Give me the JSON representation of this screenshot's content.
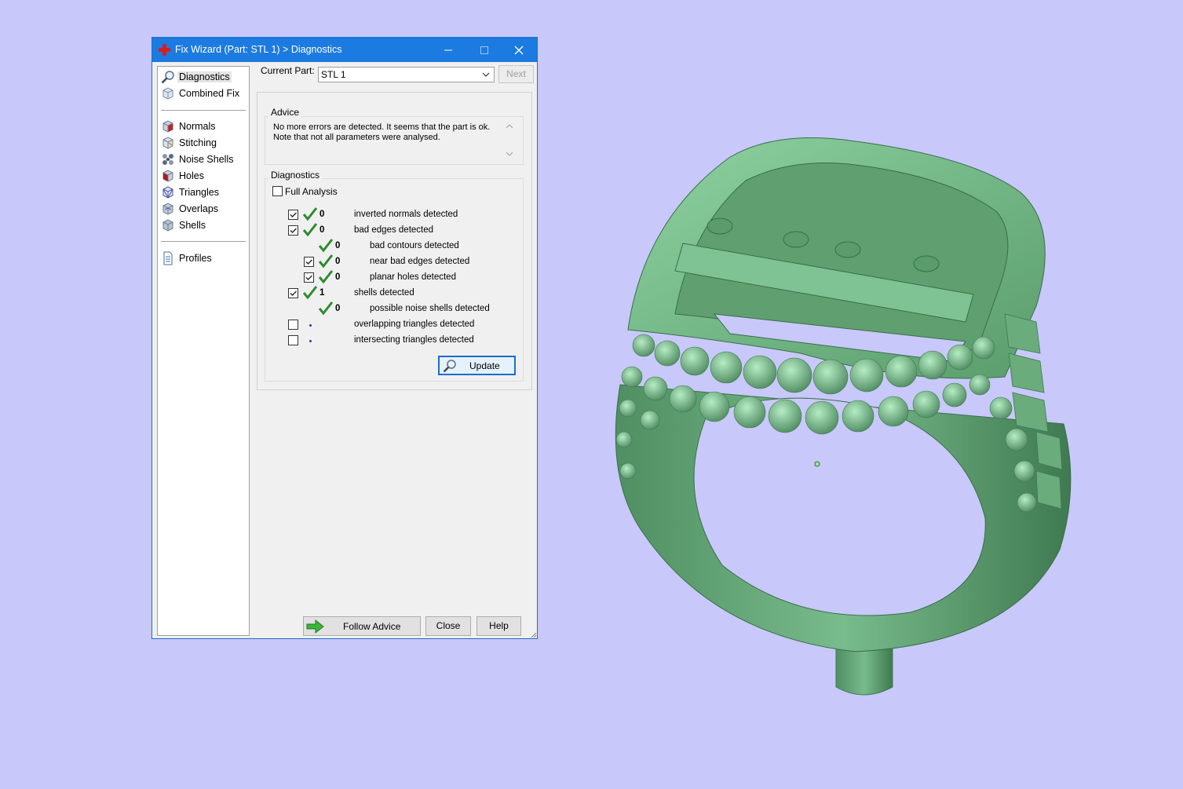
{
  "colors": {
    "background": "#c8c8fa",
    "titlebar": "#1c7be0",
    "ring_green": "#6bb07f",
    "check_green": "#2e8b2e",
    "app_icon_red": "#d42020"
  },
  "window": {
    "title": "Fix Wizard (Part: STL 1) > Diagnostics",
    "controls": [
      "minimize-icon",
      "maximize-icon",
      "close-icon"
    ]
  },
  "nav": {
    "group1": [
      {
        "label": "Diagnostics",
        "icon": "magnifier-icon",
        "selected": true
      },
      {
        "label": "Combined Fix",
        "icon": "cube-icon"
      }
    ],
    "group2": [
      {
        "label": "Normals",
        "icon": "cube-red-face-icon"
      },
      {
        "label": "Stitching",
        "icon": "cube-stitch-icon"
      },
      {
        "label": "Noise Shells",
        "icon": "noise-shells-icon"
      },
      {
        "label": "Holes",
        "icon": "cube-holes-icon"
      },
      {
        "label": "Triangles",
        "icon": "cube-triangles-icon"
      },
      {
        "label": "Overlaps",
        "icon": "cube-overlaps-icon"
      },
      {
        "label": "Shells",
        "icon": "cube-shells-icon"
      }
    ],
    "group3": [
      {
        "label": "Profiles",
        "icon": "document-icon"
      }
    ]
  },
  "current_part": {
    "label": "Current Part:",
    "value": "STL 1",
    "next_label": "Next"
  },
  "advice": {
    "label": "Advice",
    "text_line1": "No more errors are detected. It seems that the part is ok.",
    "text_line2": "Note that not all parameters were analysed."
  },
  "diagnostics": {
    "label": "Diagnostics",
    "full_analysis_label": "Full Analysis",
    "full_analysis_checked": false,
    "rows": [
      {
        "checkbox": true,
        "checked": true,
        "status": "ok",
        "count": "0",
        "label": "inverted normals detected",
        "indent": 0
      },
      {
        "checkbox": true,
        "checked": true,
        "status": "ok",
        "count": "0",
        "label": "bad edges detected",
        "indent": 0
      },
      {
        "checkbox": false,
        "checked": false,
        "status": "ok",
        "count": "0",
        "label": "bad contours detected",
        "indent": 1
      },
      {
        "checkbox": true,
        "checked": true,
        "status": "ok",
        "count": "0",
        "label": "near bad edges detected",
        "indent": 1
      },
      {
        "checkbox": true,
        "checked": true,
        "status": "ok",
        "count": "0",
        "label": "planar holes detected",
        "indent": 1
      },
      {
        "checkbox": true,
        "checked": true,
        "status": "ok",
        "count": "1",
        "label": "shells detected",
        "indent": 0
      },
      {
        "checkbox": false,
        "checked": false,
        "status": "ok",
        "count": "0",
        "label": "possible noise shells detected",
        "indent": 1
      },
      {
        "checkbox": true,
        "checked": false,
        "status": "unknown",
        "count": "",
        "label": "overlapping triangles detected",
        "indent": 0
      },
      {
        "checkbox": true,
        "checked": false,
        "status": "unknown",
        "count": "",
        "label": "intersecting triangles detected",
        "indent": 0
      }
    ],
    "update_label": "Update"
  },
  "footer": {
    "follow_advice_label": "Follow Advice",
    "close_label": "Close",
    "help_label": "Help"
  }
}
